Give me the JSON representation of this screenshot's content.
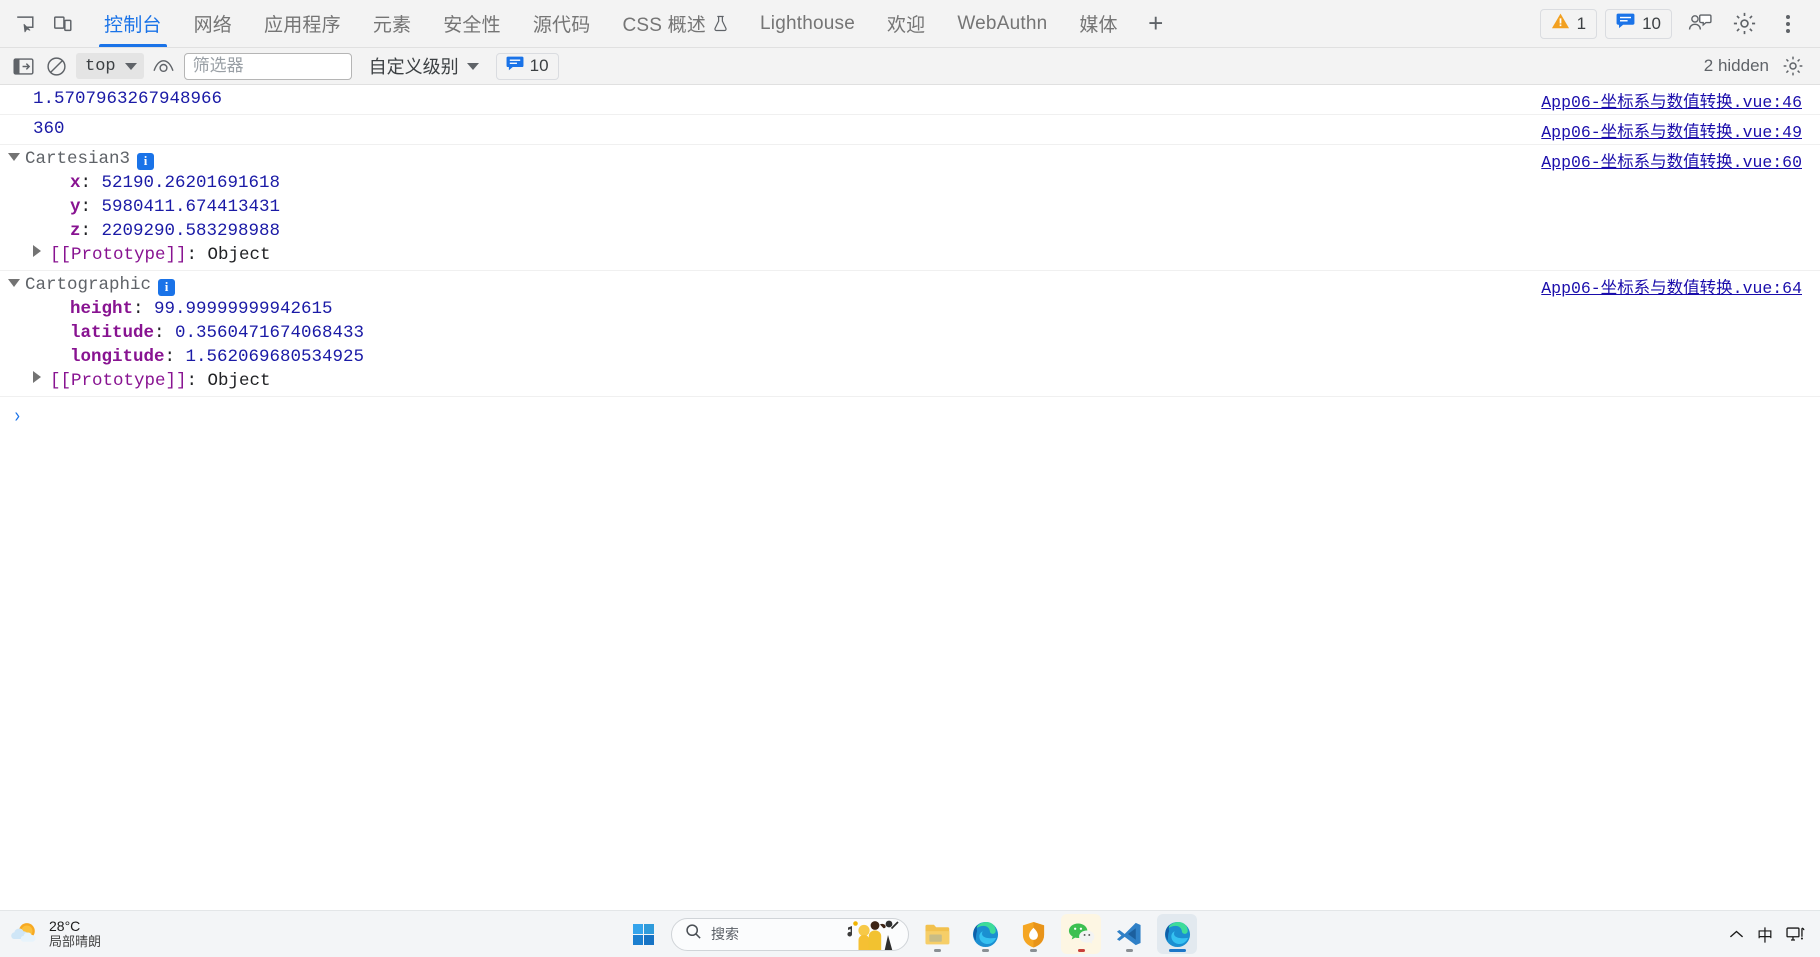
{
  "devtools": {
    "tabbar": {
      "left_icons": [
        {
          "name": "inspect-element-icon",
          "label": "检查元素"
        },
        {
          "name": "device-toolbar-icon",
          "label": "设备模拟"
        }
      ],
      "tabs": [
        {
          "label": "控制台",
          "active": true,
          "icon": ""
        },
        {
          "label": "网络",
          "active": false,
          "icon": ""
        },
        {
          "label": "应用程序",
          "active": false,
          "icon": ""
        },
        {
          "label": "元素",
          "active": false,
          "icon": ""
        },
        {
          "label": "安全性",
          "active": false,
          "icon": ""
        },
        {
          "label": "源代码",
          "active": false,
          "icon": ""
        },
        {
          "label": "CSS 概述",
          "active": false,
          "icon": "flask-icon"
        },
        {
          "label": "Lighthouse",
          "active": false,
          "icon": ""
        },
        {
          "label": "欢迎",
          "active": false,
          "icon": ""
        },
        {
          "label": "WebAuthn",
          "active": false,
          "icon": ""
        },
        {
          "label": "媒体",
          "active": false,
          "icon": ""
        }
      ],
      "add_tab_label": "+",
      "warning_count": "1",
      "message_count": "10",
      "accent_color": "#1a73e8",
      "warning_color": "#e8820c",
      "info_color": "#1a73e8"
    },
    "console_toolbar": {
      "sidebar_toggle": "console-sidebar-toggle",
      "clear_console": "clear-console",
      "context_value": "top",
      "eye_label": "live-expression",
      "filter_placeholder": "筛选器",
      "filter_value": "",
      "level_label": "自定义级别",
      "message_count": "10",
      "hidden_label": "2 hidden",
      "settings_label": "控制台设置"
    },
    "console_rows": [
      {
        "type": "value",
        "indent": 0,
        "value": "1.5707963267948966",
        "source": "App06-坐标系与数值转换.vue:46"
      },
      {
        "type": "value",
        "indent": 0,
        "value": "360",
        "source": "App06-坐标系与数值转换.vue:49"
      },
      {
        "type": "object",
        "expanded": true,
        "name": "Cartesian3",
        "badge": "i",
        "source": "App06-坐标系与数值转换.vue:60",
        "props": [
          {
            "key": "x",
            "value": "52190.26201691618"
          },
          {
            "key": "y",
            "value": "5980411.674413431"
          },
          {
            "key": "z",
            "value": "2209290.583298988"
          }
        ],
        "proto_key": "[[Prototype]]",
        "proto_value": "Object"
      },
      {
        "type": "object",
        "expanded": true,
        "name": "Cartographic",
        "badge": "i",
        "source": "App06-坐标系与数值转换.vue:64",
        "props": [
          {
            "key": "height",
            "value": "99.99999999942615"
          },
          {
            "key": "latitude",
            "value": "0.3560471674068433"
          },
          {
            "key": "longitude",
            "value": "1.562069680534925"
          }
        ],
        "proto_key": "[[Prototype]]",
        "proto_value": "Object"
      }
    ],
    "prompt": {
      "caret": "›",
      "value": "",
      "placeholder": ""
    },
    "colors": {
      "number": "#1a1aa6",
      "property": "#881391",
      "object_name": "#5f6368",
      "link": "#1a0dab"
    }
  },
  "taskbar": {
    "weather": {
      "temperature": "28°C",
      "description": "局部晴朗",
      "icon": "partly-sunny-icon"
    },
    "start_label": "开始",
    "search": {
      "placeholder": "搜索",
      "icon": "search-icon"
    },
    "apps": [
      {
        "name": "file-explorer",
        "label": "文件资源管理器",
        "active": false
      },
      {
        "name": "microsoft-edge",
        "label": "Microsoft Edge",
        "active": false
      },
      {
        "name": "firewall-app",
        "label": "安全软件",
        "active": false
      },
      {
        "name": "wechat",
        "label": "微信",
        "active": false
      },
      {
        "name": "vs-code",
        "label": "Visual Studio Code",
        "active": false
      },
      {
        "name": "microsoft-edge-window",
        "label": "Microsoft Edge",
        "active": true
      }
    ],
    "tray": {
      "overflow": "^",
      "ime": "中",
      "network_label": "网络"
    }
  }
}
